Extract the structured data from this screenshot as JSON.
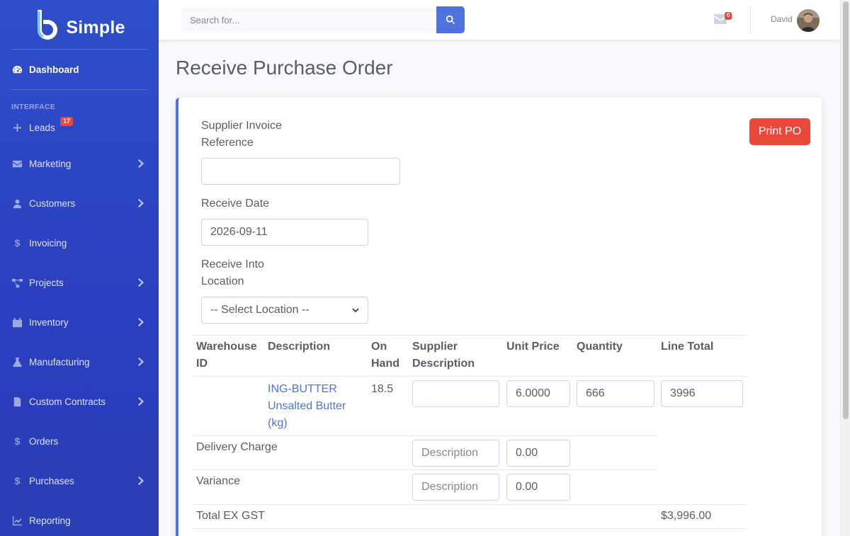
{
  "brand": {
    "name": "Simple"
  },
  "sidebar": {
    "dashboard": "Dashboard",
    "heading": "INTERFACE",
    "items": [
      {
        "label": "Leads",
        "icon": "plus-icon",
        "badge": "17",
        "chevron": false
      },
      {
        "label": "Marketing",
        "icon": "envelope-icon",
        "chevron": true
      },
      {
        "label": "Customers",
        "icon": "user-icon",
        "chevron": true
      },
      {
        "label": "Invoicing",
        "icon": "dollar-icon",
        "chevron": false
      },
      {
        "label": "Projects",
        "icon": "project-diagram-icon",
        "chevron": true
      },
      {
        "label": "Inventory",
        "icon": "calendar-icon",
        "chevron": true
      },
      {
        "label": "Manufacturing",
        "icon": "flask-icon",
        "chevron": true
      },
      {
        "label": "Custom Contracts",
        "icon": "file-icon",
        "chevron": true
      },
      {
        "label": "Orders",
        "icon": "dollar-icon",
        "chevron": false
      },
      {
        "label": "Purchases",
        "icon": "dollar-icon",
        "chevron": true
      },
      {
        "label": "Reporting",
        "icon": "chart-icon",
        "chevron": false
      }
    ]
  },
  "topbar": {
    "search_placeholder": "Search for...",
    "messages_count": "0",
    "user_name": "David"
  },
  "page": {
    "title": "Receive Purchase Order",
    "print_button": "Print PO"
  },
  "form": {
    "supplier_invoice_label_1": "Supplier Invoice",
    "supplier_invoice_label_2": "Reference",
    "supplier_invoice_value": "",
    "receive_date_label": "Receive Date",
    "receive_date_value": "2026-09-11",
    "location_label_1": "Receive Into",
    "location_label_2": "Location",
    "location_value": "-- Select Location --"
  },
  "table": {
    "headers": {
      "warehouse_1": "Warehouse",
      "warehouse_2": "ID",
      "description": "Description",
      "onhand_1": "On",
      "onhand_2": "Hand",
      "supplier_1": "Supplier",
      "supplier_2": "Description",
      "unit_price": "Unit Price",
      "quantity": "Quantity",
      "line_total": "Line Total"
    },
    "row": {
      "warehouse_id": "",
      "description_1": "ING-BUTTER",
      "description_2": "Unsalted Butter",
      "description_3": "(kg)",
      "on_hand": "18.5",
      "supplier_description": "",
      "unit_price": "6.0000",
      "quantity": "666",
      "line_total": "3996"
    },
    "delivery": {
      "label": "Delivery Charge",
      "description_placeholder": "Description",
      "amount": "0.00"
    },
    "variance": {
      "label": "Variance",
      "description_placeholder": "Description",
      "amount": "0.00"
    },
    "total_ex_gst": {
      "label": "Total EX GST",
      "value": "$3,996.00"
    }
  }
}
